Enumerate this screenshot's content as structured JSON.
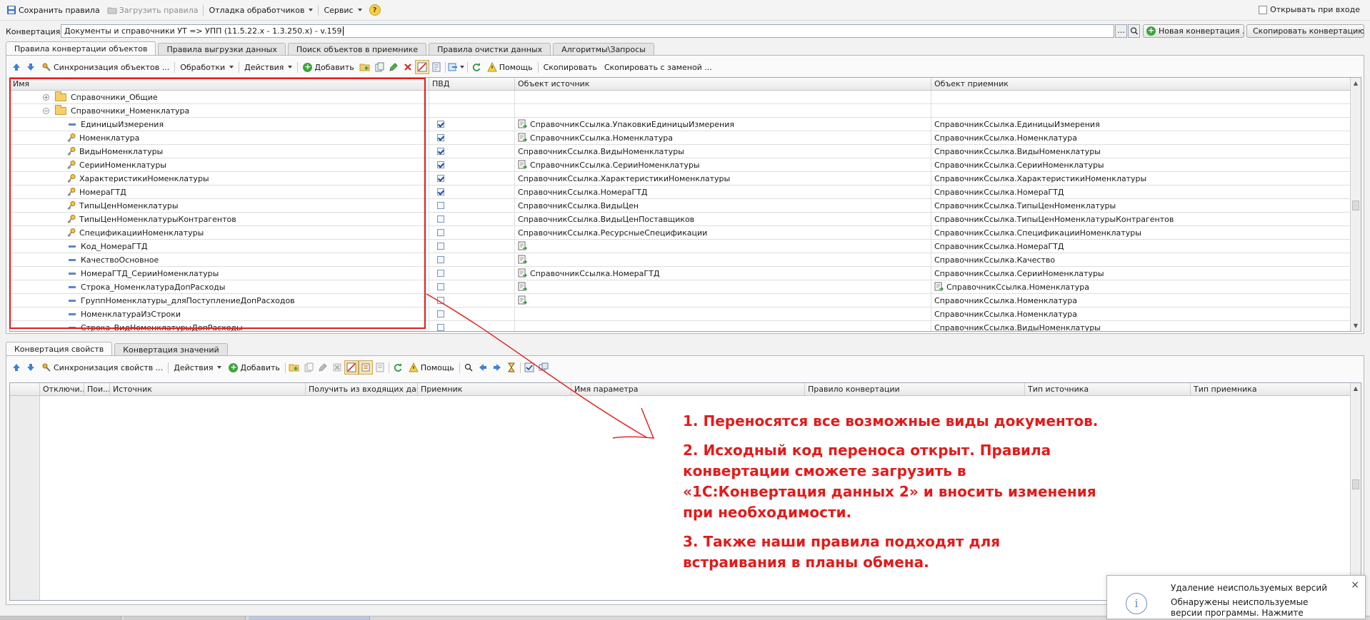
{
  "toolbar_top": {
    "save": "Сохранить правила",
    "load": "Загрузить правила",
    "debug": "Отладка обработчиков",
    "service": "Сервис",
    "help": "?",
    "open_on_start": "Открывать при входе",
    "open_on_start_checked": false
  },
  "conversion_bar": {
    "label": "Конвертация:",
    "value": "Документы и справочники УТ => УПП (11.5.22.x - 1.3.250.x) - v.159",
    "new_button": "Новая конвертация ...",
    "copy_button": "Скопировать конвертацию"
  },
  "main_tabs": [
    {
      "label": "Правила конвертации объектов",
      "active": true
    },
    {
      "label": "Правила выгрузки данных",
      "active": false
    },
    {
      "label": "Поиск объектов в приемнике",
      "active": false
    },
    {
      "label": "Правила очистки данных",
      "active": false
    },
    {
      "label": "Алгоритмы\\Запросы",
      "active": false
    }
  ],
  "rules_toolbar": {
    "sync": "Синхронизация объектов ...",
    "processing": "Обработки",
    "actions": "Действия",
    "add": "Добавить",
    "help": "Помощь",
    "copy": "Скопировать",
    "copy_replace": "Скопировать с заменой ..."
  },
  "rules_grid": {
    "columns": [
      "Имя",
      "ПВД",
      "Объект источник",
      "Объект приемник"
    ],
    "rows": [
      {
        "name": "Справочники_Общие",
        "type": "folder",
        "expand": "+",
        "level": 0,
        "pvd": false,
        "source": "",
        "source_icon": false,
        "target": "",
        "target_icon": false
      },
      {
        "name": "Справочники_Номенклатура",
        "type": "folder",
        "expand": "−",
        "level": 0,
        "pvd": false,
        "source": "",
        "source_icon": false,
        "target": "",
        "target_icon": false
      },
      {
        "name": "ЕдиницыИзмерения",
        "type": "rule",
        "level": 1,
        "pvd": true,
        "source": "СправочникСсылка.УпаковкиЕдиницыИзмерения",
        "source_icon": true,
        "target": "СправочникСсылка.ЕдиницыИзмерения",
        "target_icon": false
      },
      {
        "name": "Номенклатура",
        "type": "key",
        "level": 1,
        "pvd": true,
        "source": "СправочникСсылка.Номенклатура",
        "source_icon": true,
        "target": "СправочникСсылка.Номенклатура",
        "target_icon": false
      },
      {
        "name": "ВидыНоменклатуры",
        "type": "key",
        "level": 1,
        "pvd": true,
        "source": "СправочникСсылка.ВидыНоменклатуры",
        "source_icon": false,
        "target": "СправочникСсылка.ВидыНоменклатуры",
        "target_icon": false
      },
      {
        "name": "СерииНоменклатуры",
        "type": "key",
        "level": 1,
        "pvd": true,
        "source": "СправочникСсылка.СерииНоменклатуры",
        "source_icon": true,
        "target": "СправочникСсылка.СерииНоменклатуры",
        "target_icon": false
      },
      {
        "name": "ХарактеристикиНоменклатуры",
        "type": "key",
        "level": 1,
        "pvd": true,
        "source": "СправочникСсылка.ХарактеристикиНоменклатуры",
        "source_icon": false,
        "target": "СправочникСсылка.ХарактеристикиНоменклатуры",
        "target_icon": false
      },
      {
        "name": "НомераГТД",
        "type": "key",
        "level": 1,
        "pvd": true,
        "source": "СправочникСсылка.НомераГТД",
        "source_icon": false,
        "target": "СправочникСсылка.НомераГТД",
        "target_icon": false
      },
      {
        "name": "ТипыЦенНоменклатуры",
        "type": "key",
        "level": 1,
        "pvd": false,
        "source": "СправочникСсылка.ВидыЦен",
        "source_icon": false,
        "target": "СправочникСсылка.ТипыЦенНоменклатуры",
        "target_icon": false
      },
      {
        "name": "ТипыЦенНоменклатурыКонтрагентов",
        "type": "key",
        "level": 1,
        "pvd": false,
        "source": "СправочникСсылка.ВидыЦенПоставщиков",
        "source_icon": false,
        "target": "СправочникСсылка.ТипыЦенНоменклатурыКонтрагентов",
        "target_icon": false
      },
      {
        "name": "СпецификацииНоменклатуры",
        "type": "key",
        "level": 1,
        "pvd": false,
        "source": "СправочникСсылка.РесурсныеСпецификации",
        "source_icon": false,
        "target": "СправочникСсылка.СпецификацииНоменклатуры",
        "target_icon": false
      },
      {
        "name": "Код_НомераГТД",
        "type": "rule",
        "level": 1,
        "pvd": false,
        "source": "",
        "source_icon": true,
        "target": "СправочникСсылка.НомераГТД",
        "target_icon": false
      },
      {
        "name": "КачествоОсновное",
        "type": "rule",
        "level": 1,
        "pvd": false,
        "source": "",
        "source_icon": true,
        "target": "СправочникСсылка.Качество",
        "target_icon": false
      },
      {
        "name": "НомераГТД_СерииНоменклатуры",
        "type": "rule",
        "level": 1,
        "pvd": false,
        "source": "СправочникСсылка.НомераГТД",
        "source_icon": true,
        "target": "СправочникСсылка.СерииНоменклатуры",
        "target_icon": false
      },
      {
        "name": "Строка_НоменклатураДопРасходы",
        "type": "rule",
        "level": 1,
        "pvd": false,
        "source": "",
        "source_icon": true,
        "target": "СправочникСсылка.Номенклатура",
        "target_icon": true
      },
      {
        "name": "ГруппНоменклатуры_дляПоступлениеДопРасходов",
        "type": "rule",
        "level": 1,
        "pvd": false,
        "source": "",
        "source_icon": true,
        "target": "СправочникСсылка.Номенклатура",
        "target_icon": false
      },
      {
        "name": "НоменклатураИзСтроки",
        "type": "rule",
        "level": 1,
        "pvd": false,
        "source": "",
        "source_icon": false,
        "target": "СправочникСсылка.Номенклатура",
        "target_icon": false
      },
      {
        "name": "Строка_ВидНоменклатурыДопРасходы",
        "type": "rule",
        "level": 1,
        "pvd": false,
        "source": "",
        "source_icon": false,
        "target": "СправочникСсылка.ВидыНоменклатуры",
        "target_icon": false
      }
    ]
  },
  "bottom_tabs": [
    {
      "label": "Конвертация свойств",
      "active": true
    },
    {
      "label": "Конвертация значений",
      "active": false
    }
  ],
  "props_toolbar": {
    "sync": "Синхронизация свойств ...",
    "actions": "Действия",
    "add": "Добавить",
    "help": "Помощь"
  },
  "props_grid": {
    "columns": [
      "Отключи...",
      "Пои...",
      "Источник",
      "Получить из входящих данн...",
      "Приемник",
      "Имя параметра",
      "Правило конвертации",
      "Тип источника",
      "Тип приемника"
    ]
  },
  "annotation": {
    "p1": "1. Переносятся все возможные виды документов.",
    "p2": "2. Исходный код переноса открыт. Правила конвертации сможете загрузить в «1С:Конвертация данных 2» и вносить изменения при необходимости.",
    "p3": "3. Также наши правила подходят для встраивания в планы обмена.",
    "color": "#e31b1b"
  },
  "notification": {
    "title": "Удаление неиспользуемых версий",
    "body": "Обнаружены неиспользуемые версии программы. Нажмите здесь для",
    "close": "×",
    "info": "i"
  }
}
